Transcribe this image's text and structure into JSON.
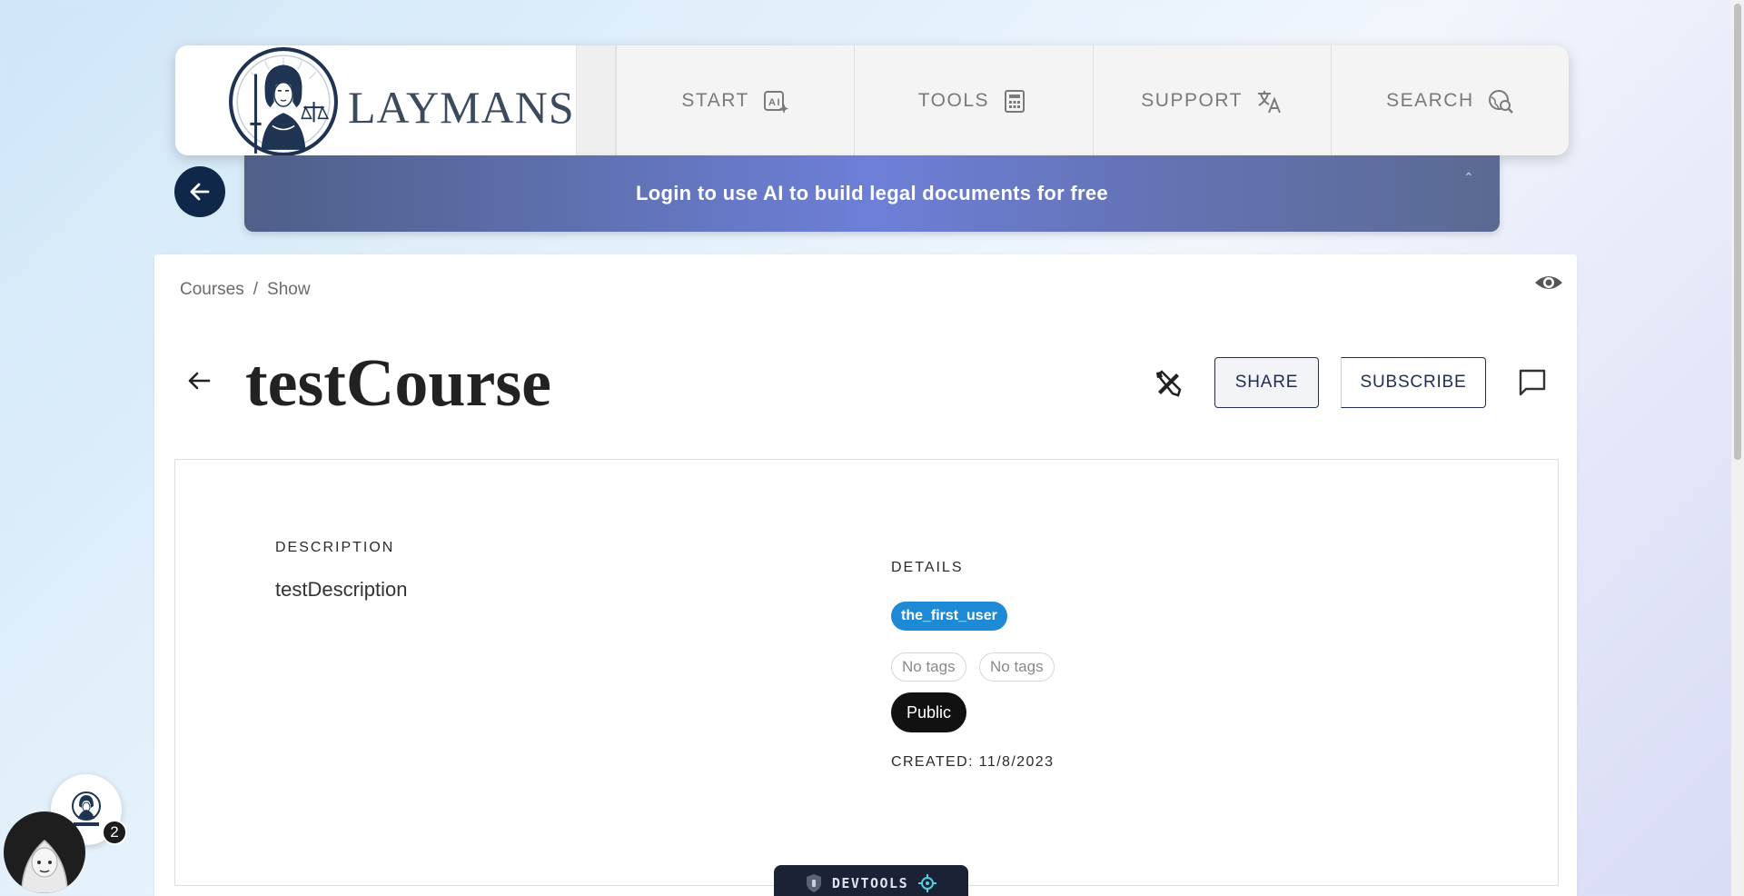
{
  "brand": {
    "name": "LAYMANS"
  },
  "nav": [
    {
      "label": "START",
      "icon": "ai-sparkle-icon"
    },
    {
      "label": "TOOLS",
      "icon": "calculator-icon"
    },
    {
      "label": "SUPPORT",
      "icon": "translate-icon"
    },
    {
      "label": "SEARCH",
      "icon": "globe-search-icon"
    }
  ],
  "banner": {
    "text": "Login to use AI to build legal documents for free"
  },
  "breadcrumb": {
    "items": [
      "Courses",
      "Show"
    ],
    "separator": "/"
  },
  "page": {
    "title": "testCourse"
  },
  "actions": {
    "share_label": "SHARE",
    "subscribe_label": "SUBSCRIBE"
  },
  "description": {
    "label": "DESCRIPTION",
    "value": "testDescription"
  },
  "details": {
    "label": "DETAILS",
    "owner": "the_first_user",
    "tags": [
      "No tags",
      "No tags"
    ],
    "visibility": "Public",
    "created_label": "CREATED:",
    "created_value": "11/8/2023"
  },
  "widgets": {
    "notification_count": "2",
    "devtools_label": "DEVTOOLS"
  },
  "colors": {
    "nav_dark": "#0f2748",
    "accent_blue": "#1e8ad6",
    "button_navy": "#1c2d5a",
    "banner_violet": "#6d7fd8"
  }
}
